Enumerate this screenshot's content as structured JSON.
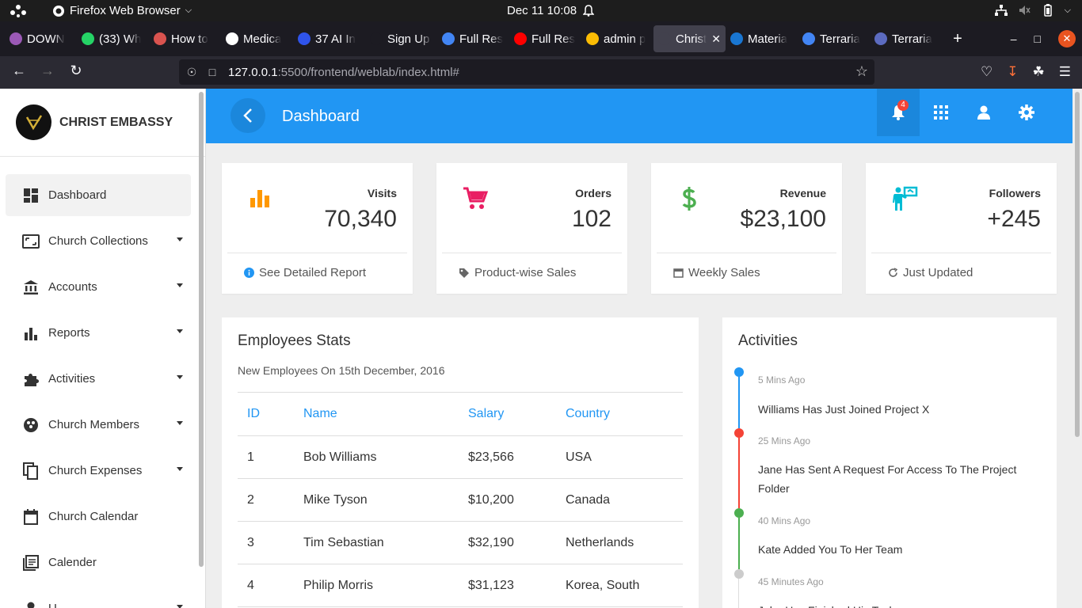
{
  "os": {
    "app_name": "Firefox Web Browser",
    "clock": "Dec 11  10:08"
  },
  "tabs": [
    {
      "label": "DOWN",
      "color": "#9b59b6"
    },
    {
      "label": "(33) Wh",
      "color": "#25d366"
    },
    {
      "label": "How to",
      "color": "#d9534f"
    },
    {
      "label": "Medica",
      "color": "#ffffff"
    },
    {
      "label": "37 AI In",
      "color": "#2f54eb"
    },
    {
      "label": "Sign Up | L",
      "color": "#1c1b22"
    },
    {
      "label": "Full Res",
      "color": "#4285f4"
    },
    {
      "label": "Full Res",
      "color": "#ff0000"
    },
    {
      "label": "admin p",
      "color": "#fbbc04"
    },
    {
      "label": "Christ Em",
      "color": "#42414d",
      "active": true
    },
    {
      "label": "Materia",
      "color": "#1976d2"
    },
    {
      "label": "Terraria",
      "color": "#4285f4"
    },
    {
      "label": "Terraria",
      "color": "#5c6bc0"
    }
  ],
  "browser": {
    "url_host": "127.0.0.1",
    "url_path": ":5500/frontend/weblab/index.html#"
  },
  "sidebar": {
    "brand": "CHRIST EMBASSY",
    "items": [
      {
        "label": "Dashboard",
        "icon": "dashboard-icon",
        "dropdown": false,
        "active": true
      },
      {
        "label": "Church Collections",
        "icon": "collections-icon",
        "dropdown": true
      },
      {
        "label": "Accounts",
        "icon": "bank-icon",
        "dropdown": true
      },
      {
        "label": "Reports",
        "icon": "bar-chart-icon",
        "dropdown": true
      },
      {
        "label": "Activities",
        "icon": "puzzle-icon",
        "dropdown": true
      },
      {
        "label": "Church Members",
        "icon": "members-icon",
        "dropdown": true
      },
      {
        "label": "Church Expenses",
        "icon": "copy-icon",
        "dropdown": true
      },
      {
        "label": "Church Calendar",
        "icon": "calendar-icon",
        "dropdown": false
      },
      {
        "label": "Calender",
        "icon": "list-icon",
        "dropdown": false
      },
      {
        "label": "U",
        "icon": "user-icon",
        "dropdown": true
      }
    ]
  },
  "header": {
    "title": "Dashboard",
    "notification_count": "4"
  },
  "cards": [
    {
      "label": "Visits",
      "value": "70,340",
      "footer": "See Detailed Report",
      "color": "#ff9800",
      "icon": "bar-chart-icon",
      "footer_icon": "info-icon"
    },
    {
      "label": "Orders",
      "value": "102",
      "footer": "Product-wise Sales",
      "color": "#e91e63",
      "icon": "cart-icon",
      "footer_icon": "tag-icon"
    },
    {
      "label": "Revenue",
      "value": "$23,100",
      "footer": "Weekly Sales",
      "color": "#4caf50",
      "icon": "dollar-icon",
      "footer_icon": "calendar-icon"
    },
    {
      "label": "Followers",
      "value": "+245",
      "footer": "Just Updated",
      "color": "#00bcd4",
      "icon": "presenter-icon",
      "footer_icon": "refresh-icon"
    }
  ],
  "employees": {
    "title": "Employees Stats",
    "subtitle": "New Employees On 15th December, 2016",
    "columns": [
      "ID",
      "Name",
      "Salary",
      "Country"
    ],
    "rows": [
      [
        "1",
        "Bob Williams",
        "$23,566",
        "USA"
      ],
      [
        "2",
        "Mike Tyson",
        "$10,200",
        "Canada"
      ],
      [
        "3",
        "Tim Sebastian",
        "$32,190",
        "Netherlands"
      ],
      [
        "4",
        "Philip Morris",
        "$31,123",
        "Korea, South"
      ]
    ]
  },
  "activities": {
    "title": "Activities",
    "items": [
      {
        "time": "5 Mins Ago",
        "text": "Williams Has Just Joined Project X",
        "color": "#2196f3"
      },
      {
        "time": "25 Mins Ago",
        "text": "Jane Has Sent A Request For Access To The Project Folder",
        "color": "#f44336"
      },
      {
        "time": "40 Mins Ago",
        "text": "Kate Added You To Her Team",
        "color": "#4caf50"
      },
      {
        "time": "45 Minutes Ago",
        "text": "John Has Finished His Task",
        "color": "#cccccc"
      }
    ]
  }
}
